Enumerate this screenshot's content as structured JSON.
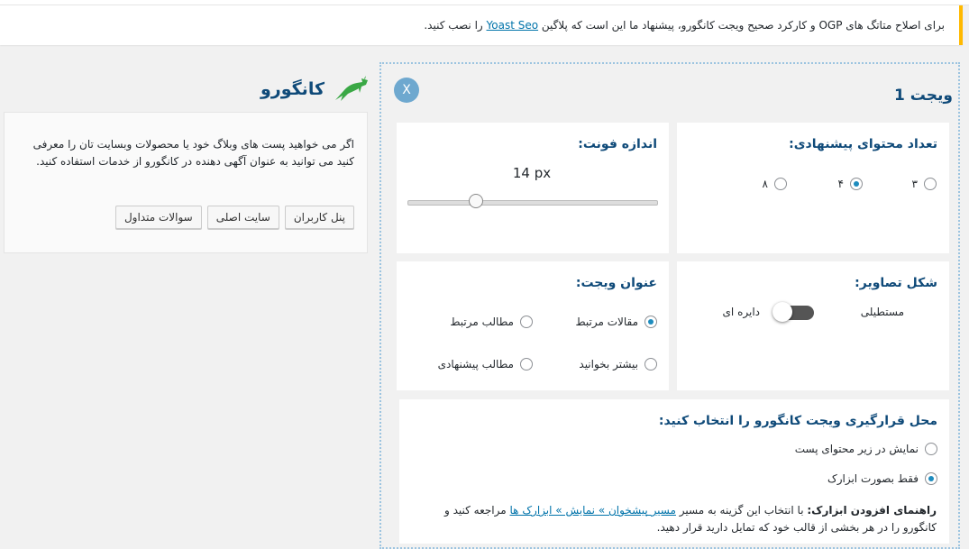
{
  "notice": {
    "text_before": "برای اصلاح متاتگ های OGP و کارکرد صحیح ویجت کانگورو، پیشنهاد ما این است که پلاگین",
    "link": "Yoast Seo",
    "text_after": "را نصب کنید."
  },
  "brand": {
    "name": "کانگورو",
    "logo_icon": "kangaroo-icon"
  },
  "promo": {
    "text": "اگر می خواهید پست های وبلاگ خود یا محصولات وبسایت تان را معرفی کنید می توانید به عنوان آگهی دهنده در کانگورو از خدمات استفاده کنید.",
    "buttons": [
      "پنل کاربران",
      "سایت اصلی",
      "سوالات متداول"
    ]
  },
  "widget": {
    "title": "ویجت 1",
    "close_label": "X",
    "count": {
      "title": "تعداد محتوای پیشنهادی:",
      "options": [
        {
          "label": "۳",
          "checked": false
        },
        {
          "label": "۴",
          "checked": true
        },
        {
          "label": "۸",
          "checked": false
        }
      ]
    },
    "font": {
      "title": "اندازه فونت:",
      "value": "14 px",
      "level": 0.27
    },
    "shape": {
      "title": "شکل تصاویر:",
      "option_a": "مستطیلی",
      "option_b": "دایره ای",
      "is_circle": false
    },
    "widget_title": {
      "title": "عنوان ویجت:",
      "options": [
        {
          "label": "مقالات مرتبط",
          "checked": true
        },
        {
          "label": "مطالب مرتبط",
          "checked": false
        },
        {
          "label": "بیشتر بخوانید",
          "checked": false
        },
        {
          "label": "مطالب پیشنهادی",
          "checked": false
        }
      ]
    },
    "placement": {
      "title": "محل قرارگیری ویجت کانگورو را انتخاب کنید:",
      "options": [
        {
          "label": "نمایش در زیر محتوای پست",
          "checked": false
        },
        {
          "label": "فقط بصورت ابزارک",
          "checked": true
        }
      ],
      "guide_bold": "راهنمای افزودن ابزارک:",
      "guide_text1": "با انتخاب این گزینه به مسیر",
      "guide_link": "مسیر پیشخوان » نمایش » ابزارک ها",
      "guide_text2": "مراجعه کنید و کانگورو را در هر بخشی از قالب خود که تمایل دارید قرار دهید."
    }
  },
  "colors": {
    "accent": "#0f4a79",
    "notice_border": "#ffb900",
    "link": "#0073aa"
  }
}
